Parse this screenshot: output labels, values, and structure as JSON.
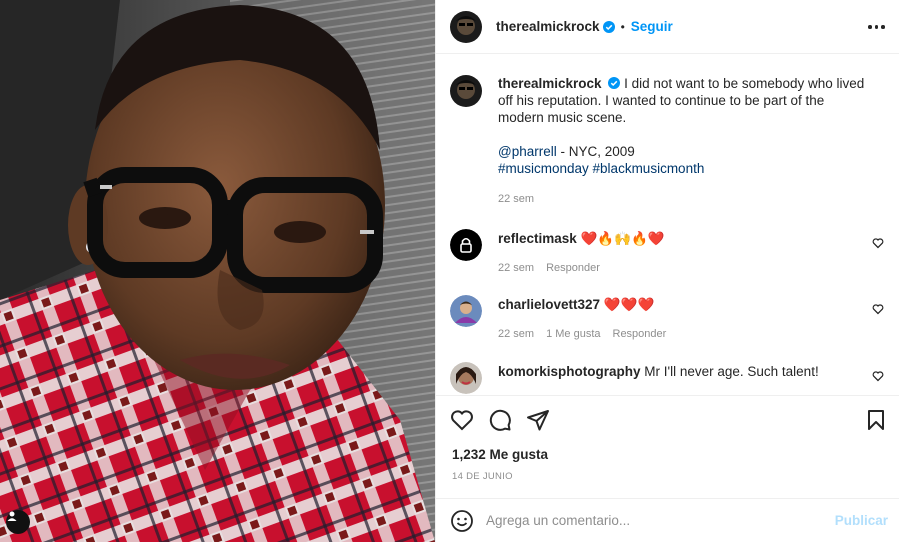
{
  "post": {
    "author": "therealmickrock",
    "follow_label": "Seguir",
    "separator": "•",
    "image_alt_icon": "user-tag-icon"
  },
  "caption": {
    "username": "therealmickrock",
    "text": "I did not want to be somebody who lived off his reputation. I wanted to continue to be part of the modern music scene.",
    "mention": "@pharrell",
    "location_text": " - NYC, 2009",
    "hashtags": "#musicmonday #blackmusicmonth",
    "time": "22 sem"
  },
  "comments": [
    {
      "username": "reflectimask",
      "text": "❤️🔥🙌🔥❤️",
      "time": "22 sem",
      "likes": "",
      "reply": "Responder"
    },
    {
      "username": "charlielovett327",
      "text": "❤️❤️❤️",
      "time": "22 sem",
      "likes": "1 Me gusta",
      "reply": "Responder"
    },
    {
      "username": "komorkisphotography",
      "text": "Mr I'll never age. Such talent!",
      "time": "",
      "likes": "",
      "reply": ""
    }
  ],
  "stats": {
    "likes": "1,232 Me gusta",
    "date": "14 DE JUNIO"
  },
  "composer": {
    "placeholder": "Agrega un comentario...",
    "publish_label": "Publicar"
  },
  "colors": {
    "link": "#00376b",
    "accent": "#0095f6",
    "publish_disabled": "#b2dffc",
    "heart": "#ed4956"
  }
}
